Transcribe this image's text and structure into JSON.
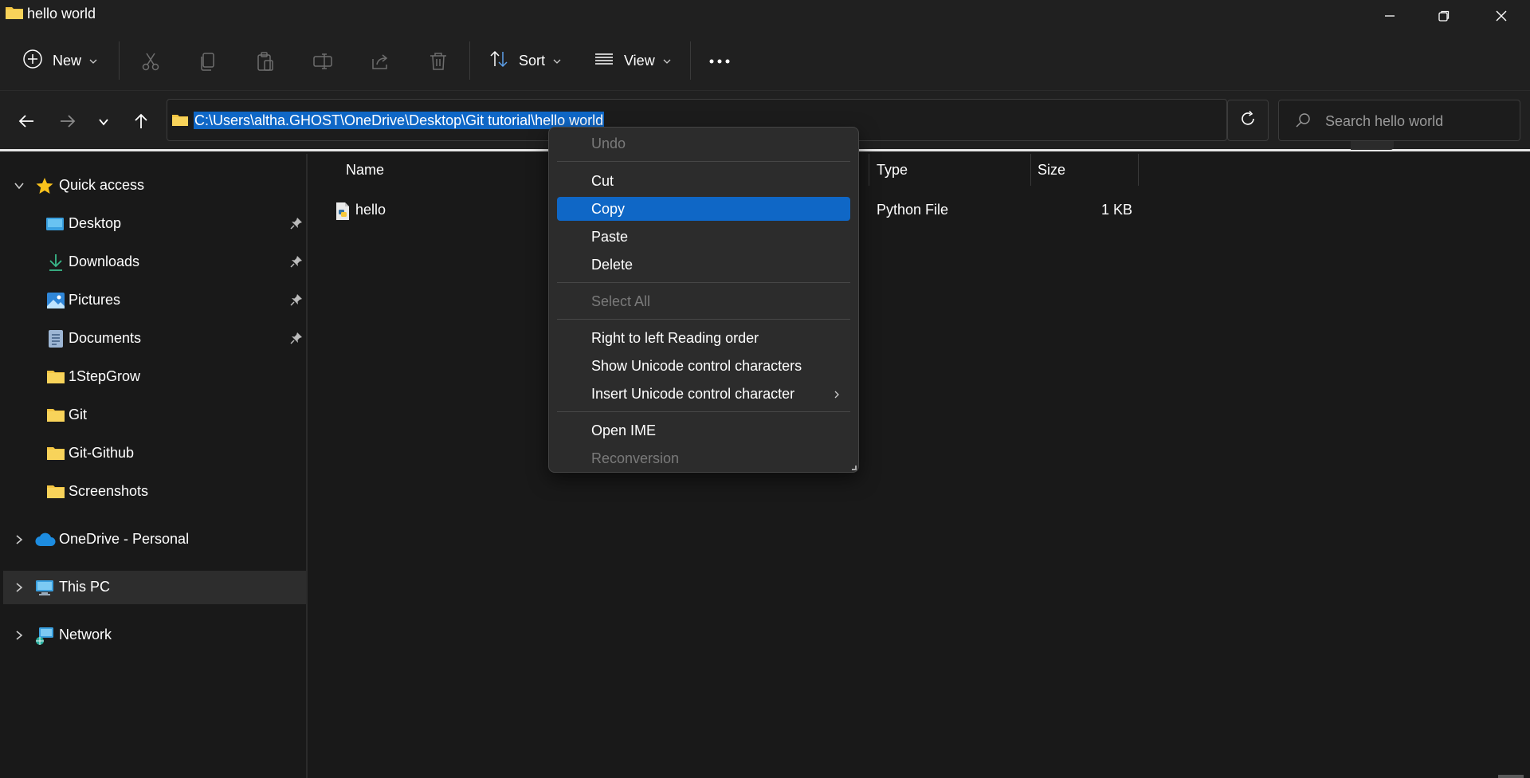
{
  "window": {
    "title": "hello world"
  },
  "command_bar": {
    "new_label": "New",
    "sort_label": "Sort",
    "view_label": "View"
  },
  "address_bar": {
    "path": "C:\\Users\\altha.GHOST\\OneDrive\\Desktop\\Git tutorial\\hello world",
    "search_placeholder": "Search hello world"
  },
  "sidebar": {
    "quick_access": "Quick access",
    "items": [
      {
        "label": "Desktop",
        "icon": "desktop-icon",
        "pinned": true
      },
      {
        "label": "Downloads",
        "icon": "download-icon",
        "pinned": true
      },
      {
        "label": "Pictures",
        "icon": "pictures-icon",
        "pinned": true
      },
      {
        "label": "Documents",
        "icon": "documents-icon",
        "pinned": true
      },
      {
        "label": "1StepGrow",
        "icon": "folder-icon",
        "pinned": false
      },
      {
        "label": "Git",
        "icon": "folder-icon",
        "pinned": false
      },
      {
        "label": "Git-Github",
        "icon": "folder-icon",
        "pinned": false
      },
      {
        "label": "Screenshots",
        "icon": "folder-icon",
        "pinned": false
      }
    ],
    "onedrive": "OneDrive - Personal",
    "this_pc": "This PC",
    "network": "Network"
  },
  "file_list": {
    "columns": {
      "name": "Name",
      "type": "Type",
      "size": "Size"
    },
    "rows": [
      {
        "name": "hello",
        "type": "Python File",
        "size": "1 KB"
      }
    ]
  },
  "context_menu": {
    "items": [
      {
        "label": "Undo",
        "state": "disabled"
      },
      {
        "label": "Cut",
        "state": "enabled"
      },
      {
        "label": "Copy",
        "state": "highlighted"
      },
      {
        "label": "Paste",
        "state": "enabled"
      },
      {
        "label": "Delete",
        "state": "enabled"
      },
      {
        "label": "Select All",
        "state": "disabled"
      },
      {
        "label": "Right to left Reading order",
        "state": "enabled"
      },
      {
        "label": "Show Unicode control characters",
        "state": "enabled"
      },
      {
        "label": "Insert Unicode control character",
        "state": "enabled",
        "submenu": true
      },
      {
        "label": "Open IME",
        "state": "enabled"
      },
      {
        "label": "Reconversion",
        "state": "disabled"
      }
    ]
  },
  "colors": {
    "accent": "#0f67c6",
    "background": "#191919",
    "folder": "#f4c542"
  }
}
